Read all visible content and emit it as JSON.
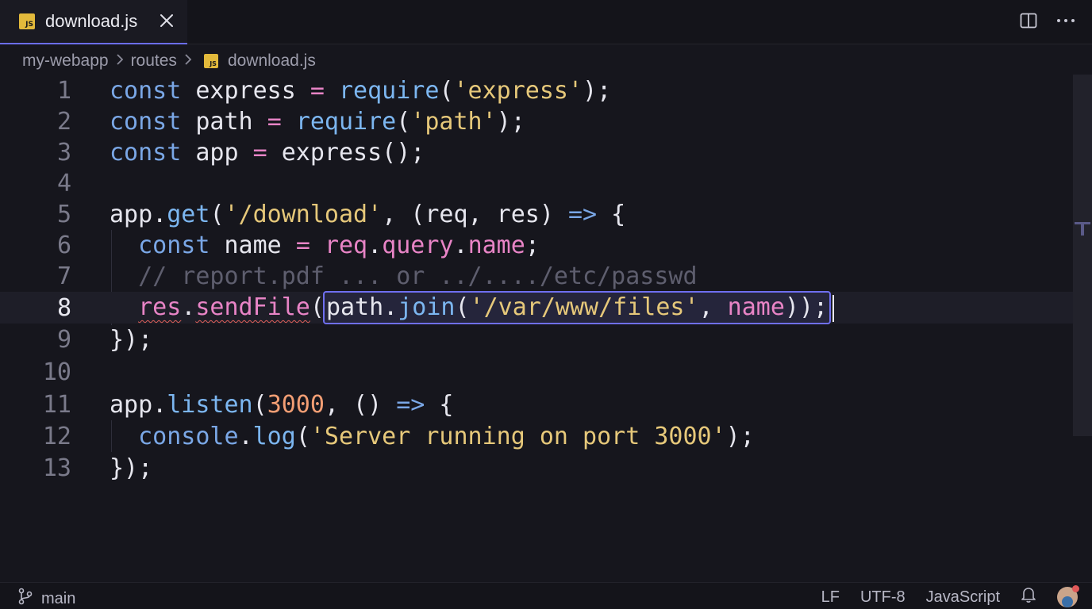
{
  "tab": {
    "icon": "js-file-icon",
    "badge": "JS",
    "label": "download.js"
  },
  "breadcrumb": {
    "items": [
      "my-webapp",
      "routes",
      "download.js"
    ],
    "badge": "JS"
  },
  "editor": {
    "current_line": 8,
    "line_numbers": [
      "1",
      "2",
      "3",
      "4",
      "5",
      "6",
      "7",
      "8",
      "9",
      "10",
      "11",
      "12",
      "13"
    ],
    "lines": [
      "const express = require('express');",
      "const path = require('path');",
      "const app = express();",
      "",
      "app.get('/download', (req, res) => {",
      "  const name = req.query.name;",
      "  // report.pdf ... or ../..../etc/passwd",
      "  res.sendFile(path.join('/var/www/files', name));",
      "});",
      "",
      "app.listen(3000, () => {",
      "  console.log('Server running on port 3000');",
      "});"
    ],
    "selection_text": "path.join('/var/www/files', name));"
  },
  "status": {
    "branch": "main",
    "eol": "LF",
    "encoding": "UTF-8",
    "language": "JavaScript"
  },
  "colors": {
    "accent": "#6b6df2",
    "keyword": "#7aa7e6",
    "string": "#e6c87a",
    "number": "#f29e74",
    "property": "#e884c6",
    "error_squiggle": "#e0605a"
  }
}
